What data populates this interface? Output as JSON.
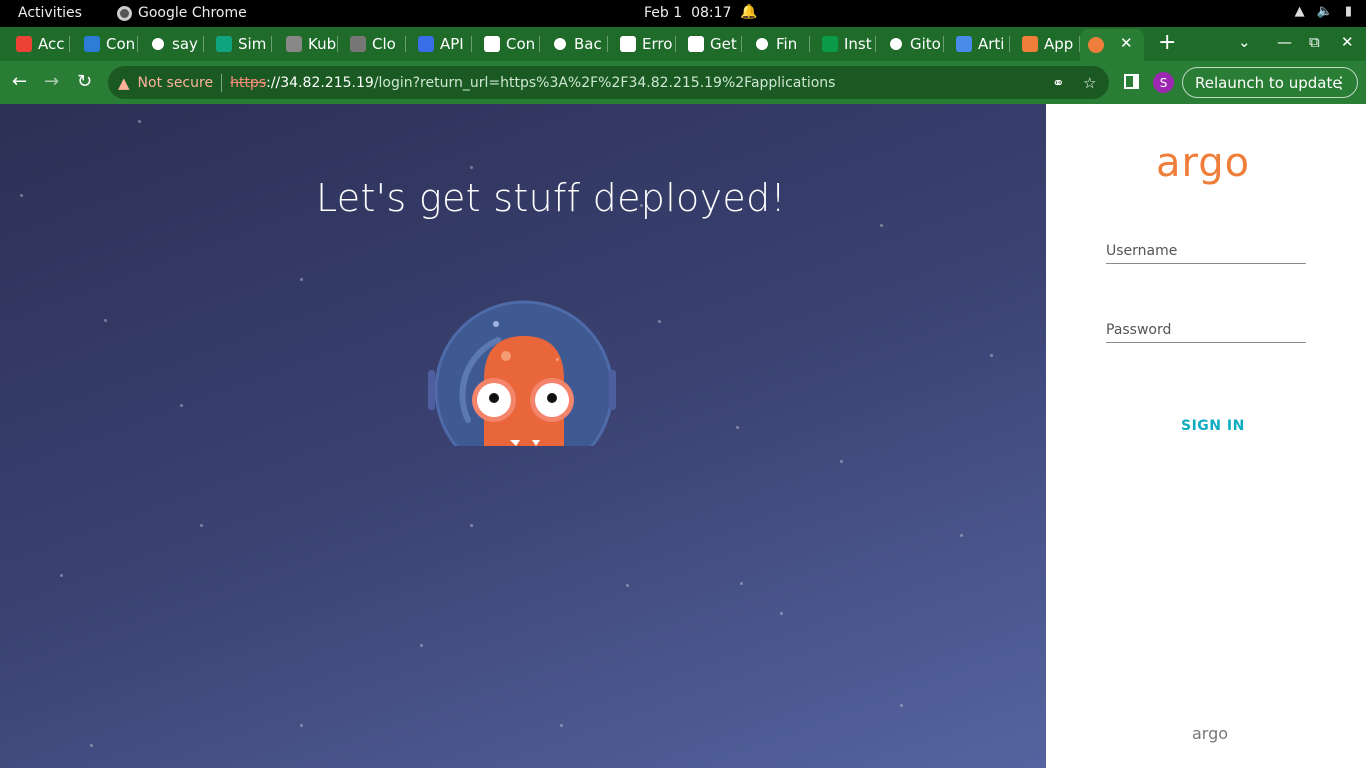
{
  "system_bar": {
    "activities": "Activities",
    "app_name": "Google Chrome",
    "date": "Feb 1",
    "time": "08:17"
  },
  "tabs": [
    {
      "label": "Acc",
      "icon": "gmail-icon",
      "color": "#ea4335"
    },
    {
      "label": "Con",
      "icon": "azure-devops-icon",
      "color": "#2d7cd6"
    },
    {
      "label": "say",
      "icon": "github-icon",
      "color": "#ffffff"
    },
    {
      "label": "Sim",
      "icon": "openai-icon",
      "color": "#10a37f"
    },
    {
      "label": "Kub",
      "icon": "kubernetes-icon",
      "color": "#888888"
    },
    {
      "label": "Clo",
      "icon": "cloud-shell-icon",
      "color": "#777777"
    },
    {
      "label": "API",
      "icon": "api-icon",
      "color": "#3a6ee8"
    },
    {
      "label": "Con",
      "icon": "helm-icon",
      "color": "#ffffff"
    },
    {
      "label": "Bac",
      "icon": "github-icon",
      "color": "#ffffff"
    },
    {
      "label": "Erro",
      "icon": "helm-icon",
      "color": "#ffffff"
    },
    {
      "label": "Get",
      "icon": "helm-icon",
      "color": "#ffffff"
    },
    {
      "label": "Fin",
      "icon": "github-icon",
      "color": "#ffffff"
    },
    {
      "label": "Inst",
      "icon": "nginx-icon",
      "color": "#0a9a48"
    },
    {
      "label": "Gito",
      "icon": "github-icon",
      "color": "#ffffff"
    },
    {
      "label": "Arti",
      "icon": "artifact-icon",
      "color": "#4a8ae8"
    },
    {
      "label": "App",
      "icon": "argo-icon",
      "color": "#ee7e3a"
    }
  ],
  "toolbar": {
    "not_secure": "Not secure",
    "url_scheme": "https",
    "url_host": "://34.82.215.19",
    "url_rest": "/login?return_url=https%3A%2F%2F34.82.215.19%2Fapplications",
    "avatar_letter": "S",
    "relaunch": "Relaunch to update"
  },
  "page": {
    "headline": "Let's get stuff deployed!",
    "logo": "argo",
    "username_label": "Username",
    "password_label": "Password",
    "sign_in": "SIGN IN",
    "footer_logo": "argo"
  },
  "colors": {
    "tab_strip": "#1e6b2a",
    "toolbar": "#2a7d35",
    "argo_orange": "#ee7e3a",
    "sign_in": "#0dadc0"
  }
}
